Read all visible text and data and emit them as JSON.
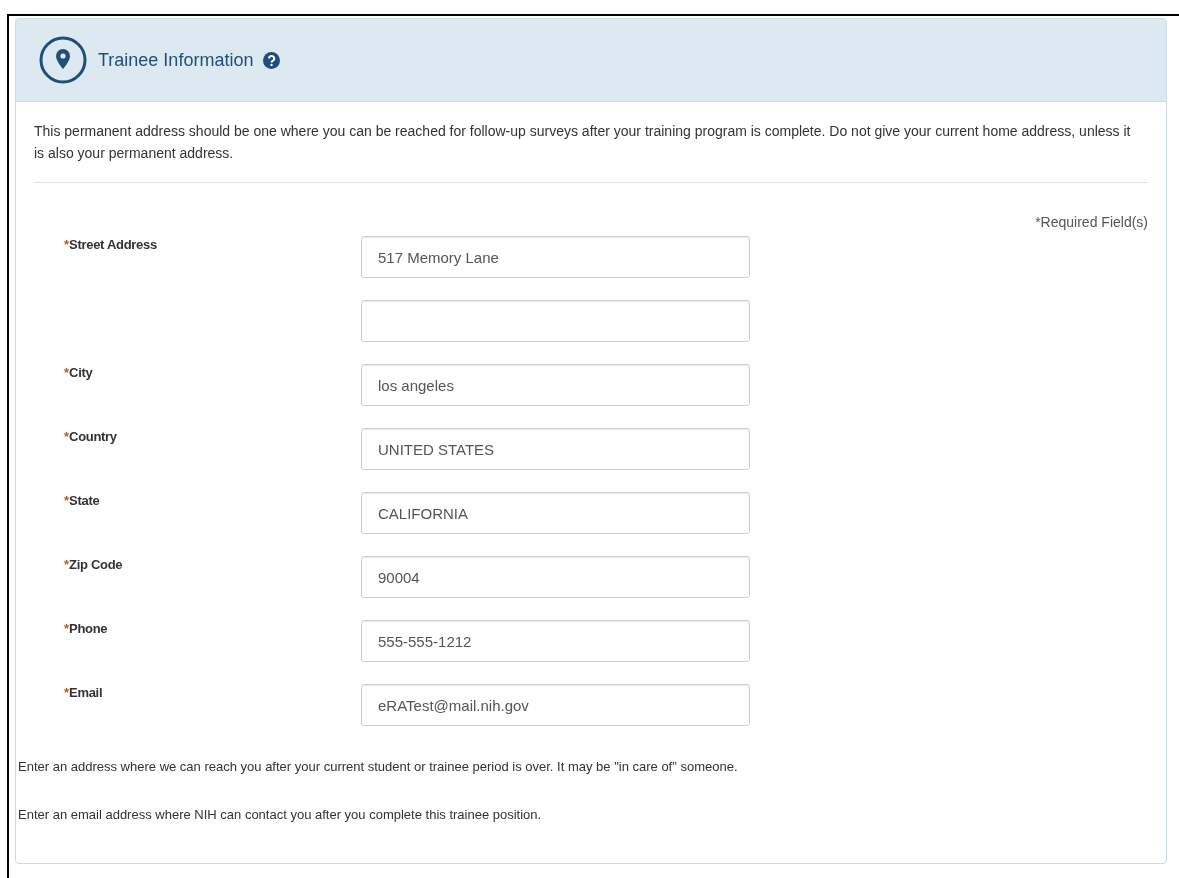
{
  "panel": {
    "title": "Trainee Information",
    "intro": "This permanent address should be one where you can be reached for follow-up surveys after your training program is complete. Do not give your current home address, unless it is also your permanent address.",
    "required_note": "*Required Field(s)",
    "fields": [
      {
        "mark": "*",
        "label": "Street Address",
        "value": "517 Memory Lane",
        "second_line": true
      },
      {
        "mark": "*",
        "label": "City",
        "value": "los angeles"
      },
      {
        "mark": "*",
        "label": "Country",
        "value": "UNITED STATES"
      },
      {
        "mark": "*",
        "label": "State",
        "value": "CALIFORNIA"
      },
      {
        "mark": "*",
        "label": "Zip Code",
        "value": "90004"
      },
      {
        "mark": "*",
        "label": "Phone",
        "value": "555-555-1212"
      },
      {
        "mark": "*",
        "label": "Email",
        "value": "eRATest@mail.nih.gov"
      }
    ],
    "notes": [
      "Enter an address where we can reach you after your current student or trainee period is over. It may be \"in care of\" someone.",
      "Enter an email address where NIH can contact you after you complete this trainee position."
    ]
  }
}
